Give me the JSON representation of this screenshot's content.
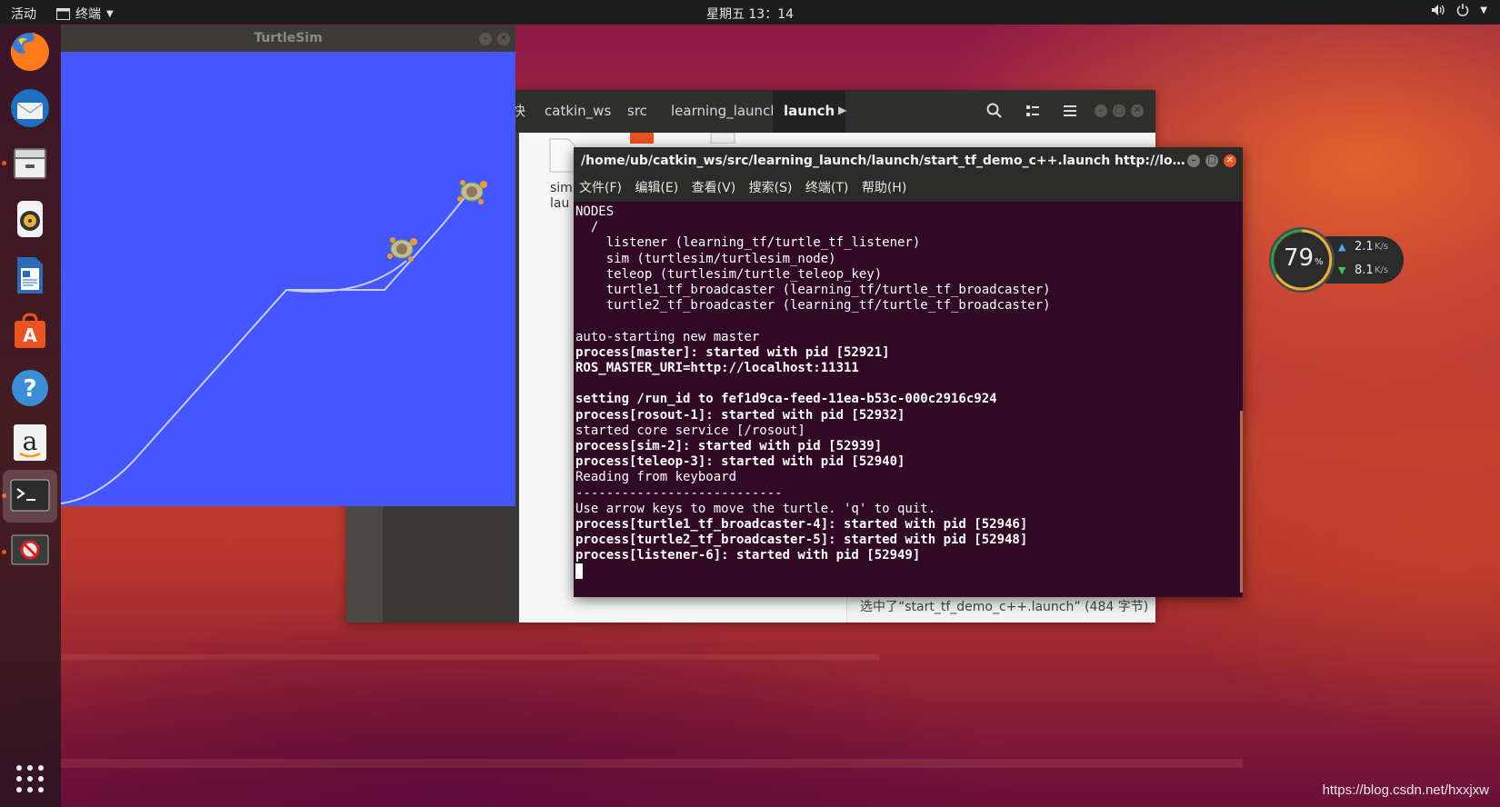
{
  "topbar": {
    "activities": "活动",
    "app_name": "终端",
    "clock": "星期五 13：14",
    "volume_icon": "volume-icon",
    "power_icon": "power-icon"
  },
  "dock": {
    "items": [
      "firefox-icon",
      "thunderbird-icon",
      "files-icon",
      "rhythmbox-icon",
      "writer-icon",
      "software-icon",
      "help-icon",
      "amazon-icon",
      "terminal-icon",
      "blocked-app-icon"
    ],
    "show_apps_icon": "grid-icon"
  },
  "turtlesim": {
    "title": "TurtleSim",
    "background_color": "#4556ff"
  },
  "files": {
    "breadcrumbs": [
      "快",
      "catkin_ws",
      "src",
      "learning_launch",
      "launch"
    ],
    "partial_labels": [
      "sim",
      "lau"
    ],
    "status": "选中了“start_tf_demo_c++.launch” (484 字节)"
  },
  "terminal": {
    "title": "/home/ub/catkin_ws/src/learning_launch/launch/start_tf_demo_c++.launch http://localhost...",
    "menu": [
      "文件(F)",
      "编辑(E)",
      "查看(V)",
      "搜索(S)",
      "终端(T)",
      "帮助(H)"
    ],
    "lines": [
      {
        "text": "NODES",
        "bold": false
      },
      {
        "text": "  /",
        "bold": false
      },
      {
        "text": "    listener (learning_tf/turtle_tf_listener)",
        "bold": false
      },
      {
        "text": "    sim (turtlesim/turtlesim_node)",
        "bold": false
      },
      {
        "text": "    teleop (turtlesim/turtle_teleop_key)",
        "bold": false
      },
      {
        "text": "    turtle1_tf_broadcaster (learning_tf/turtle_tf_broadcaster)",
        "bold": false
      },
      {
        "text": "    turtle2_tf_broadcaster (learning_tf/turtle_tf_broadcaster)",
        "bold": false
      },
      {
        "text": "",
        "bold": false
      },
      {
        "text": "auto-starting new master",
        "bold": false
      },
      {
        "text": "process[master]: started with pid [52921]",
        "bold": true
      },
      {
        "text": "ROS_MASTER_URI=http://localhost:11311",
        "bold": true
      },
      {
        "text": "",
        "bold": false
      },
      {
        "text": "setting /run_id to fef1d9ca-feed-11ea-b53c-000c2916c924",
        "bold": true
      },
      {
        "text": "process[rosout-1]: started with pid [52932]",
        "bold": true
      },
      {
        "text": "started core service [/rosout]",
        "bold": false
      },
      {
        "text": "process[sim-2]: started with pid [52939]",
        "bold": true
      },
      {
        "text": "process[teleop-3]: started with pid [52940]",
        "bold": true
      },
      {
        "text": "Reading from keyboard",
        "bold": false
      },
      {
        "text": "---------------------------",
        "bold": false
      },
      {
        "text": "Use arrow keys to move the turtle. 'q' to quit.",
        "bold": false
      },
      {
        "text": "process[turtle1_tf_broadcaster-4]: started with pid [52946]",
        "bold": true
      },
      {
        "text": "process[turtle2_tf_broadcaster-5]: started with pid [52948]",
        "bold": true
      },
      {
        "text": "process[listener-6]: started with pid [52949]",
        "bold": true
      }
    ]
  },
  "netspeed": {
    "percent": "79",
    "percent_unit": "%",
    "up": "2.1",
    "down": "8.1",
    "unit": "K/s"
  },
  "watermark": "https://blog.csdn.net/hxxjxw"
}
